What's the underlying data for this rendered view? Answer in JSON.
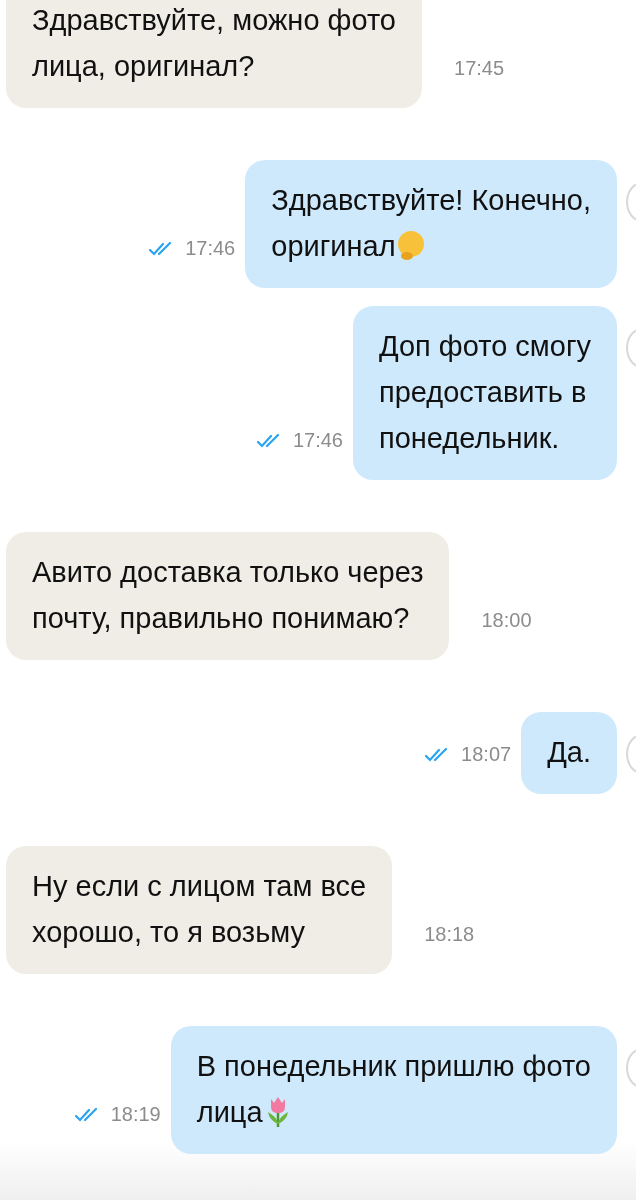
{
  "messages": [
    {
      "kind": "incoming",
      "text": "Здравствуйте, можно фото\nлица, оригинал?",
      "time": "17:45"
    },
    {
      "kind": "outgoing",
      "text": "Здравствуйте! Конечно,\nоригинал",
      "emoji": {
        "kind": "thinking"
      },
      "time": "17:46",
      "read": true
    },
    {
      "kind": "outgoing",
      "text": "Доп фото смогу\nпредоставить в\nпонедельник.",
      "time": "17:46",
      "read": true
    },
    {
      "kind": "incoming",
      "text": "Авито доставка только через\nпочту, правильно понимаю?",
      "time": "18:00"
    },
    {
      "kind": "outgoing",
      "text": "Да.",
      "time": "18:07",
      "read": true
    },
    {
      "kind": "incoming",
      "text": "Ну если с лицом там все\nхорошо, то я возьму",
      "time": "18:18"
    },
    {
      "kind": "outgoing",
      "text": "В понедельник пришлю фото\nлица",
      "emoji": {
        "kind": "tulip"
      },
      "time": "18:19",
      "read": true
    }
  ]
}
